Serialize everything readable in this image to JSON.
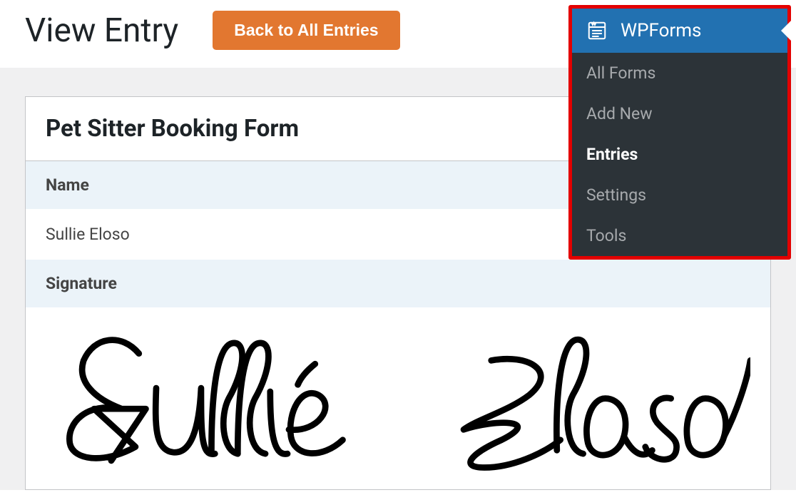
{
  "header": {
    "title": "View Entry",
    "back_button_label": "Back to All Entries"
  },
  "entry": {
    "form_name": "Pet Sitter Booking Form",
    "fields": {
      "name_label": "Name",
      "name_value": "Sullie Eloso",
      "signature_label": "Signature"
    }
  },
  "flyout": {
    "title": "WPForms",
    "items": [
      {
        "label": "All Forms",
        "active": false
      },
      {
        "label": "Add New",
        "active": false
      },
      {
        "label": "Entries",
        "active": true
      },
      {
        "label": "Settings",
        "active": false
      },
      {
        "label": "Tools",
        "active": false
      }
    ]
  }
}
